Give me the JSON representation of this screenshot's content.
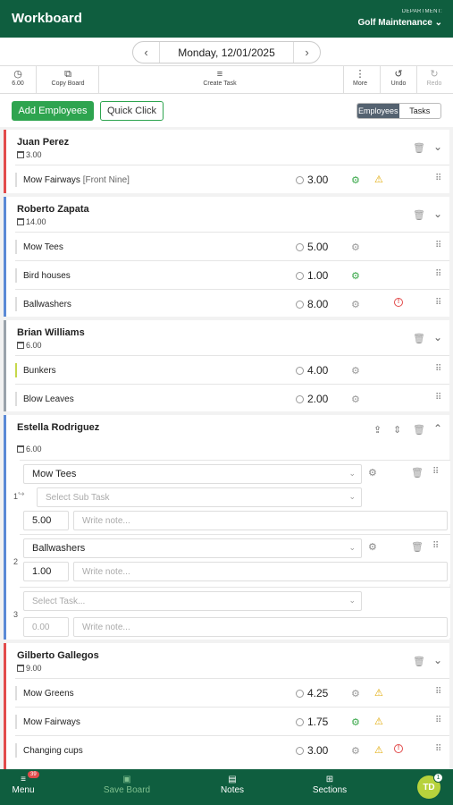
{
  "header": {
    "title": "Workboard",
    "department_label": "DEPARTMENT:",
    "department_value": "Golf Maintenance"
  },
  "datebar": {
    "date": "Monday, 12/01/2025",
    "prev_icon": "chevron-left-icon",
    "next_icon": "chevron-right-icon"
  },
  "toolbar": {
    "hours": "6.00",
    "copy_board": "Copy Board",
    "create_task": "Create Task",
    "more": "More",
    "undo": "Undo",
    "redo": "Redo"
  },
  "actions": {
    "add_employees": "Add Employees",
    "quick_click": "Quick Click",
    "view_employees": "Employees",
    "view_tasks": "Tasks",
    "active_view": "Employees"
  },
  "employees": [
    {
      "name": "Juan Perez",
      "hours": "3.00",
      "color": "#e24b4b",
      "tasks": [
        {
          "name": "Mow Fairways",
          "sub": "[Front Nine]",
          "time": "3.00",
          "gear": "green",
          "warn": true,
          "err": false
        }
      ]
    },
    {
      "name": "Roberto Zapata",
      "hours": "14.00",
      "color": "#5b8ad6",
      "tasks": [
        {
          "name": "Mow Tees",
          "time": "5.00",
          "gear": "gray",
          "warn": false,
          "err": false
        },
        {
          "name": "Bird houses",
          "time": "1.00",
          "gear": "green",
          "warn": false,
          "err": false
        },
        {
          "name": "Ballwashers",
          "time": "8.00",
          "gear": "gray",
          "warn": false,
          "err": true
        }
      ]
    },
    {
      "name": "Brian Williams",
      "hours": "6.00",
      "color": "#9aa3ab",
      "tasks": [
        {
          "name": "Bunkers",
          "time": "4.00",
          "gear": "gray",
          "warn": false,
          "err": false
        },
        {
          "name": "Blow Leaves",
          "time": "2.00",
          "gear": "gray",
          "warn": false,
          "err": false
        }
      ]
    },
    {
      "name": "Estella Rodriguez",
      "hours": "6.00",
      "color": "#5b8ad6",
      "edit_tasks": [
        {
          "num": "1",
          "task": "Mow Tees",
          "sub_placeholder": "Select Sub Task",
          "hours": "5.00",
          "note_placeholder": "Write note..."
        },
        {
          "num": "2",
          "task": "Ballwashers",
          "hours": "1.00",
          "note_placeholder": "Write note..."
        },
        {
          "num": "3",
          "task_placeholder": "Select Task...",
          "hours_placeholder": "0.00",
          "note_placeholder": "Write note..."
        }
      ]
    },
    {
      "name": "Gilberto Gallegos",
      "hours": "9.00",
      "color": "#e24b4b",
      "tasks": [
        {
          "name": "Mow Greens",
          "time": "4.25",
          "gear": "gray",
          "warn": true,
          "err": false
        },
        {
          "name": "Mow Fairways",
          "time": "1.75",
          "gear": "green",
          "warn": true,
          "err": false
        },
        {
          "name": "Changing cups",
          "time": "3.00",
          "gear": "gray",
          "warn": true,
          "err": true
        }
      ]
    }
  ],
  "footer": {
    "menu": "Menu",
    "menu_badge": "39",
    "save_board": "Save Board",
    "notes": "Notes",
    "sections": "Sections",
    "avatar": "TD",
    "avatar_badge": "1"
  }
}
